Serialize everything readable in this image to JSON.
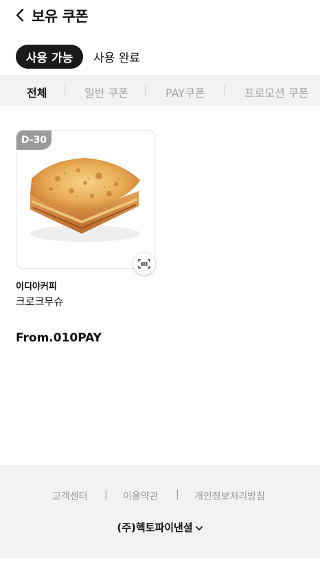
{
  "header": {
    "title": "보유 쿠폰"
  },
  "status_tabs": [
    {
      "label": "사용 가능"
    },
    {
      "label": "사용 완료"
    }
  ],
  "filter_tabs": [
    {
      "label": "전체"
    },
    {
      "label": "일반 쿠폰"
    },
    {
      "label": "PAY쿠폰"
    },
    {
      "label": "프로모션 쿠폰"
    }
  ],
  "coupons": [
    {
      "dday": "D-30",
      "brand": "이디야커피",
      "name": "크로크무슈",
      "from": "From.010PAY"
    }
  ],
  "footer": {
    "links": [
      {
        "label": "고객센터"
      },
      {
        "label": "이용약관"
      },
      {
        "label": "개인정보처리방침"
      }
    ],
    "separator": "|",
    "company": "(주)헥토파이낸셜"
  },
  "colors": {
    "active_tab_bg": "#1a1a1a",
    "filter_bar_bg": "#f2f2f2",
    "dday_badge": "#9b9b9b",
    "footer_bg": "#f2f2f2"
  },
  "icons": {
    "back": "chevron-left-icon",
    "barcode": "barcode-icon",
    "company_toggle": "chevron-down-icon"
  }
}
